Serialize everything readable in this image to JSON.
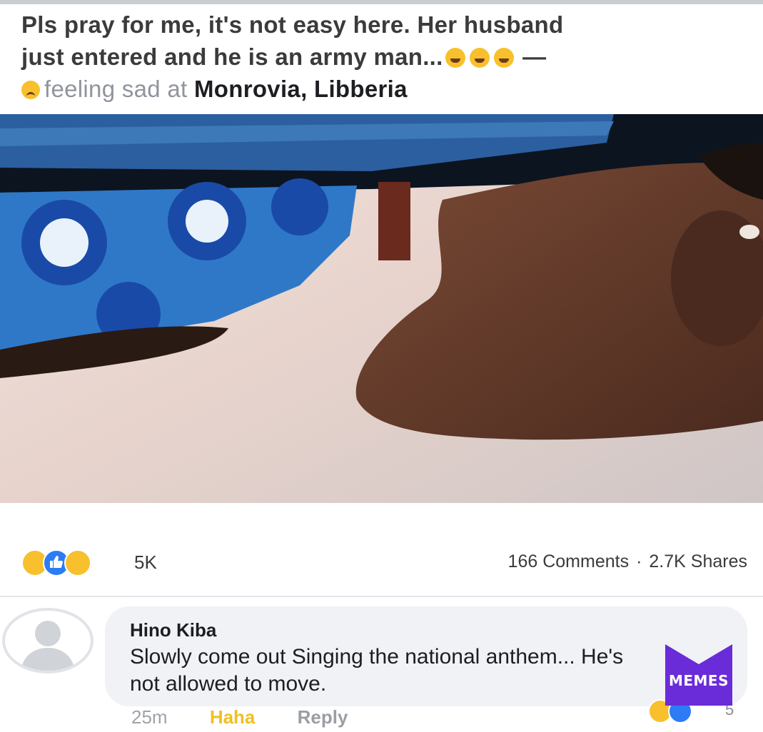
{
  "post": {
    "text_line1": "Pls pray for me, it's not easy here. Her husband",
    "text_line2": "just entered and he is an army man...",
    "text_dash": "—",
    "feeling_text": "feeling sad at",
    "location": "Monrovia, Libberia"
  },
  "reactions": {
    "count": "5K",
    "comments": "166 Comments",
    "separator": "·",
    "shares": "2.7K Shares",
    "icons": [
      "haha-icon",
      "like-icon",
      "sad-icon"
    ]
  },
  "comment": {
    "author": "Hino Kiba",
    "text": "Slowly come out Singing the national anthem... He's not allowed to move.",
    "time": "25m",
    "haha_label": "Haha",
    "reply_label": "Reply",
    "reaction_count": "5"
  },
  "watermark": {
    "text": "MEMES",
    "color": "#6a2bd9"
  },
  "colors": {
    "like_blue": "#2d7cf6",
    "haha_yellow": "#f7c02c",
    "bubble_bg": "#f0f2f5"
  }
}
